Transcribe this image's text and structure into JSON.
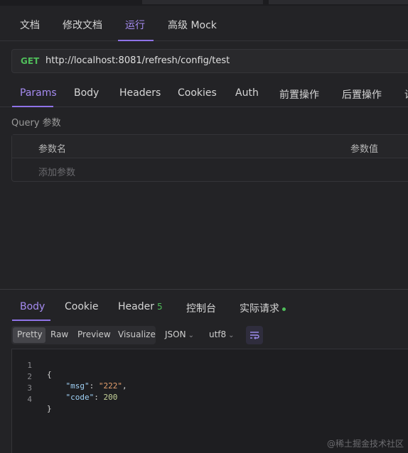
{
  "top_tabs": [
    {
      "label": "文档"
    },
    {
      "label": "修改文档"
    },
    {
      "label": "运行"
    },
    {
      "label": "高级 Mock"
    }
  ],
  "request": {
    "method": "GET",
    "url": "http://localhost:8081/refresh/config/test"
  },
  "request_tabs": [
    {
      "label": "Params"
    },
    {
      "label": "Body"
    },
    {
      "label": "Headers"
    },
    {
      "label": "Cookies"
    },
    {
      "label": "Auth"
    },
    {
      "label": "前置操作"
    },
    {
      "label": "后置操作"
    },
    {
      "label": "设"
    }
  ],
  "query": {
    "section_label": "Query 参数",
    "col_name": "参数名",
    "col_value": "参数值",
    "add_placeholder": "添加参数"
  },
  "response_tabs": [
    {
      "label": "Body"
    },
    {
      "label": "Cookie"
    },
    {
      "label": "Header",
      "badge": "5"
    },
    {
      "label": "控制台"
    },
    {
      "label": "实际请求"
    }
  ],
  "view_modes": [
    "Pretty",
    "Raw",
    "Preview",
    "Visualize"
  ],
  "format_select": "JSON",
  "encoding_select": "utf8",
  "code": {
    "line_numbers": [
      "1",
      "2",
      "3",
      "4"
    ],
    "open_brace": "{",
    "msg_key": "\"msg\"",
    "msg_value": "\"222\"",
    "code_key": "\"code\"",
    "code_value": "200",
    "close_brace": "}"
  },
  "watermark": "@稀土掘金技术社区",
  "colors": {
    "accent": "#8f73e8",
    "method_get": "#4fbd5a",
    "background": "#232326"
  }
}
